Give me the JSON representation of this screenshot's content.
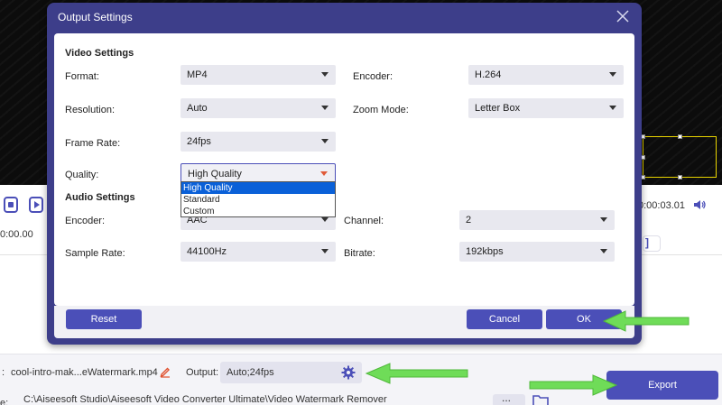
{
  "dialog": {
    "title": "Output Settings",
    "video_section": "Video Settings",
    "audio_section": "Audio Settings",
    "video": {
      "format_label": "Format:",
      "format_value": "MP4",
      "encoder_label": "Encoder:",
      "encoder_value": "H.264",
      "resolution_label": "Resolution:",
      "resolution_value": "Auto",
      "zoom_label": "Zoom Mode:",
      "zoom_value": "Letter Box",
      "framerate_label": "Frame Rate:",
      "framerate_value": "24fps",
      "quality_label": "Quality:",
      "quality_value": "High Quality",
      "quality_options": [
        "High Quality",
        "Standard",
        "Custom"
      ]
    },
    "audio": {
      "encoder_label": "Encoder:",
      "encoder_value": "AAC",
      "channel_label": "Channel:",
      "channel_value": "2",
      "samplerate_label": "Sample Rate:",
      "samplerate_value": "44100Hz",
      "bitrate_label": "Bitrate:",
      "bitrate_value": "192kbps"
    },
    "reset_label": "Reset",
    "cancel_label": "Cancel",
    "ok_label": "OK"
  },
  "player": {
    "time_right": "0:00:03.01",
    "time_left": "0:00.00"
  },
  "bottom": {
    "file_prefix": ":",
    "file_name": "cool-intro-mak...eWatermark.mp4",
    "output_label": "Output:",
    "output_value": "Auto;24fps",
    "path_label": "e:",
    "path_value": "C:\\Aiseesoft Studio\\Aiseesoft Video Converter Ultimate\\Video Watermark Remover",
    "path_dots": "...",
    "export_label": "Export"
  },
  "colors": {
    "accent": "#4b4fb8",
    "dialog_frame": "#3d3e8a",
    "annotation_arrow": "#6fdc58",
    "highlight": "#0a60d8"
  }
}
